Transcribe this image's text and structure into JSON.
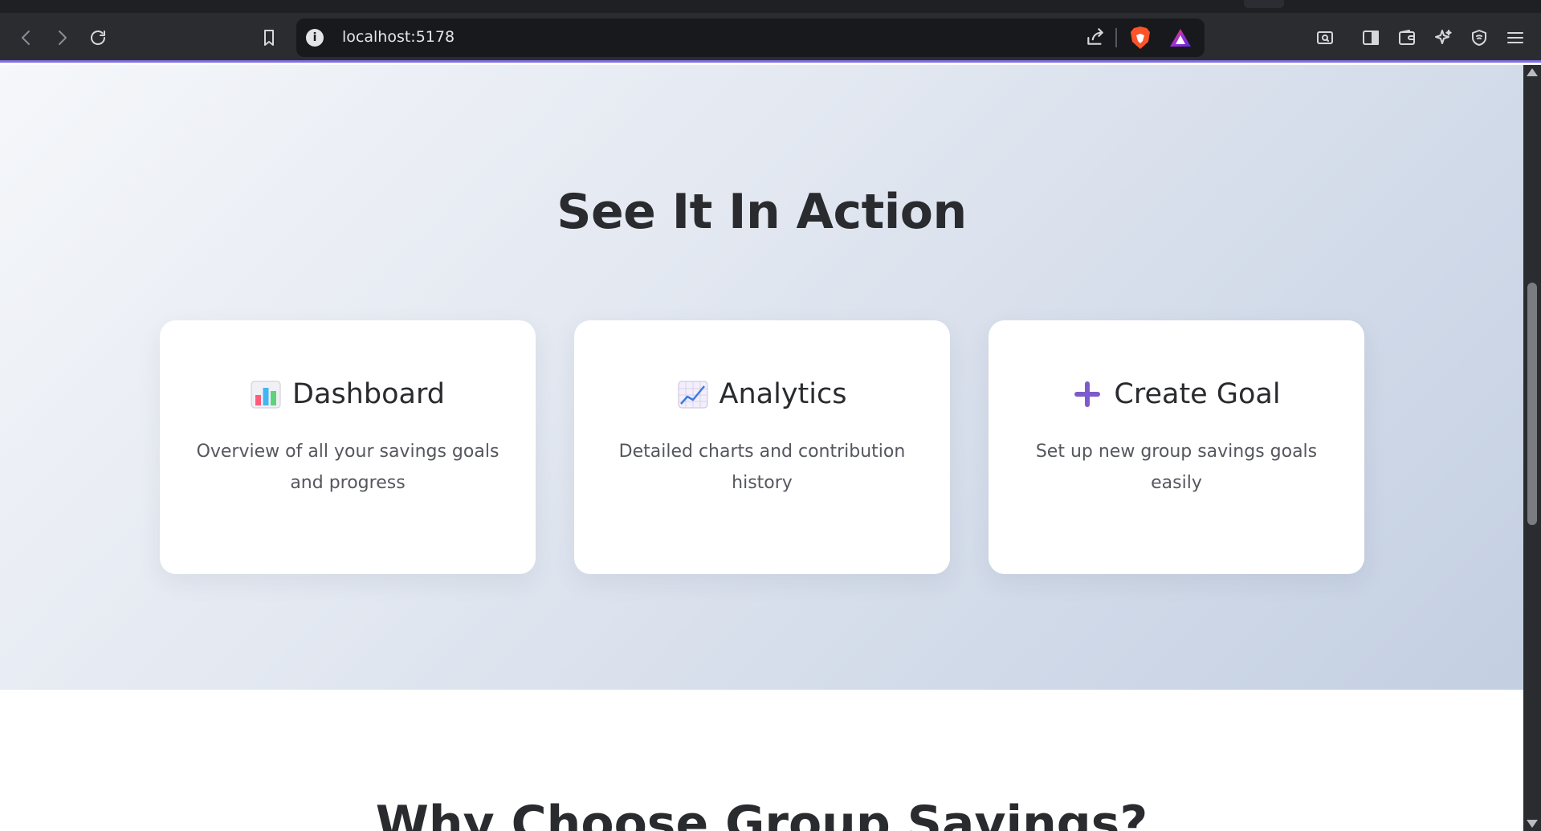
{
  "browser": {
    "url": "localhost:5178",
    "accent_color": "#7f6fe3",
    "icons": [
      "back-icon",
      "forward-icon",
      "reload-icon",
      "bookmark-icon",
      "site-info-icon",
      "share-icon",
      "brave-shields-icon",
      "brave-rewards-icon",
      "reader-mode-icon",
      "sidebar-icon",
      "wallet-icon",
      "leo-ai-icon",
      "vpn-icon",
      "menu-icon"
    ]
  },
  "page": {
    "hero": {
      "title": "See It In Action",
      "cards": [
        {
          "icon": "bar-chart-emoji-icon",
          "title": "Dashboard",
          "description": "Overview of all your savings goals and progress"
        },
        {
          "icon": "line-chart-emoji-icon",
          "title": "Analytics",
          "description": "Detailed charts and contribution history"
        },
        {
          "icon": "plus-emoji-icon",
          "title": "Create Goal",
          "description": "Set up new group savings goals easily"
        }
      ]
    },
    "next_section": {
      "title": "Why Choose Group Savings?"
    }
  }
}
